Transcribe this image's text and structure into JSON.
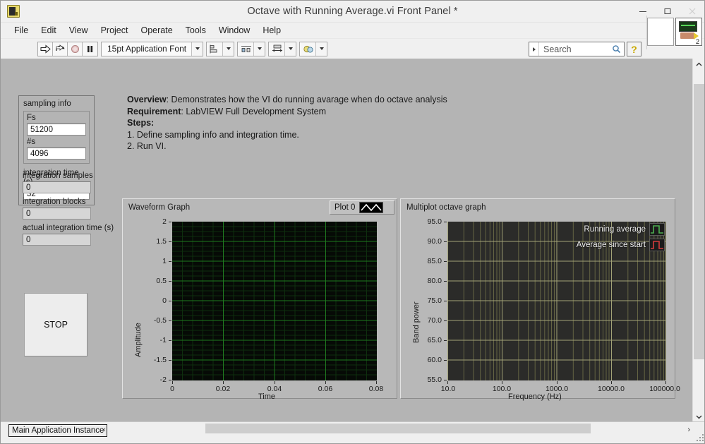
{
  "window": {
    "title": "Octave with Running Average.vi Front Panel *",
    "logo_icon": "labview-vi-icon",
    "minimize_label": "–",
    "maximize_label": "□",
    "close_label": "✕"
  },
  "menubar": {
    "items": [
      "File",
      "Edit",
      "View",
      "Project",
      "Operate",
      "Tools",
      "Window",
      "Help"
    ]
  },
  "toolbar": {
    "run_icon": "run-arrow-icon",
    "run_continuous_icon": "run-continuously-icon",
    "abort_icon": "abort-execution-icon",
    "pause_icon": "pause-icon",
    "font_selector_value": "15pt Application Font",
    "align_objects_icon": "align-objects-icon",
    "distribute_objects_icon": "distribute-objects-icon",
    "resize_objects_icon": "resize-objects-icon",
    "reorder_objects_icon": "reorder-objects-icon",
    "search_placeholder": "Search",
    "search_value": "",
    "search_icon": "magnifier-icon",
    "help_icon": "help-question-icon",
    "connector_pane_icon": "vi-connector-pane",
    "connector_pane_count": "2"
  },
  "panel": {
    "overview": {
      "overview_label": "Overview",
      "overview_text": ": Demonstrates how the VI do running avarage when do octave analysis",
      "requirement_label": "Requirement",
      "requirement_text": ": LabVIEW Full Development System",
      "steps_label": "Steps",
      "steps_colon": ":",
      "step1": "1. Define sampling info and integration time.",
      "step2": "2. Run VI."
    },
    "sampling_cluster": {
      "title": "sampling info",
      "fs_label": "Fs",
      "fs_value": "51200",
      "ns_label": "#s",
      "ns_value": "4096",
      "integration_time_label": "integration time (s)",
      "integration_time_value": "32"
    },
    "indicators": [
      {
        "label": "integration samples",
        "value": "0"
      },
      {
        "label": "integration blocks",
        "value": "0"
      },
      {
        "label": "actual integration time (s)",
        "value": "0"
      }
    ],
    "stop_button_label": "STOP"
  },
  "chart_data": [
    {
      "type": "line",
      "name": "waveform-graph",
      "title": "Waveform Graph",
      "xlabel": "Time",
      "ylabel": "Amplitude",
      "xlim": [
        0,
        0.08
      ],
      "ylim": [
        -2,
        2
      ],
      "xticks": [
        "0",
        "0.02",
        "0.04",
        "0.06",
        "0.08"
      ],
      "yticks": [
        "2",
        "1.5",
        "1",
        "0.5",
        "0-",
        "-0.5",
        "-1",
        "-1.5",
        "-2"
      ],
      "ytick_labels": [
        "2",
        "1.5",
        "1",
        "0.5",
        "0",
        "-0.5",
        "-1",
        "-1.5",
        "-2"
      ],
      "grid": true,
      "grid_color": "#1f7a1f",
      "background": "#060a06",
      "legend_position": "top-right",
      "series": [
        {
          "name": "Plot 0",
          "color": "#ffffff",
          "values": []
        }
      ]
    },
    {
      "type": "line",
      "name": "multiplot-octave-graph",
      "title": "Multiplot octave graph",
      "xlabel": "Frequency (Hz)",
      "ylabel": "Band power",
      "xscale": "log",
      "xlim": [
        10,
        100000
      ],
      "ylim": [
        55,
        95
      ],
      "xticks": [
        "10.0",
        "100.0",
        "1000.0",
        "10000.0",
        "100000.0"
      ],
      "ytick_labels": [
        "95.0",
        "90.0",
        "85.0",
        "80.0",
        "75.0",
        "70.0",
        "65.0",
        "60.0",
        "55.0"
      ],
      "grid": true,
      "grid_color": "#8a8a5a",
      "background": "#2b2b29",
      "legend_position": "top-right-inside",
      "series": [
        {
          "name": "Running average",
          "color": "#4caf50",
          "values": []
        },
        {
          "name": "Average since start",
          "color": "#d43c3c",
          "values": []
        }
      ]
    }
  ],
  "statusbar": {
    "app_instance": "Main Application Instance",
    "left_arrow": "‹",
    "right_arrow": "›"
  },
  "colors": {
    "panel_bg": "#b4b4b4",
    "chrome_bg": "#f0f0f0",
    "waveform_bg": "#060a06",
    "waveform_grid": "#1f7a1f",
    "octave_bg": "#2b2b29",
    "octave_grid": "#8a8a5a",
    "running_average": "#4caf50",
    "average_since_start": "#d43c3c"
  }
}
